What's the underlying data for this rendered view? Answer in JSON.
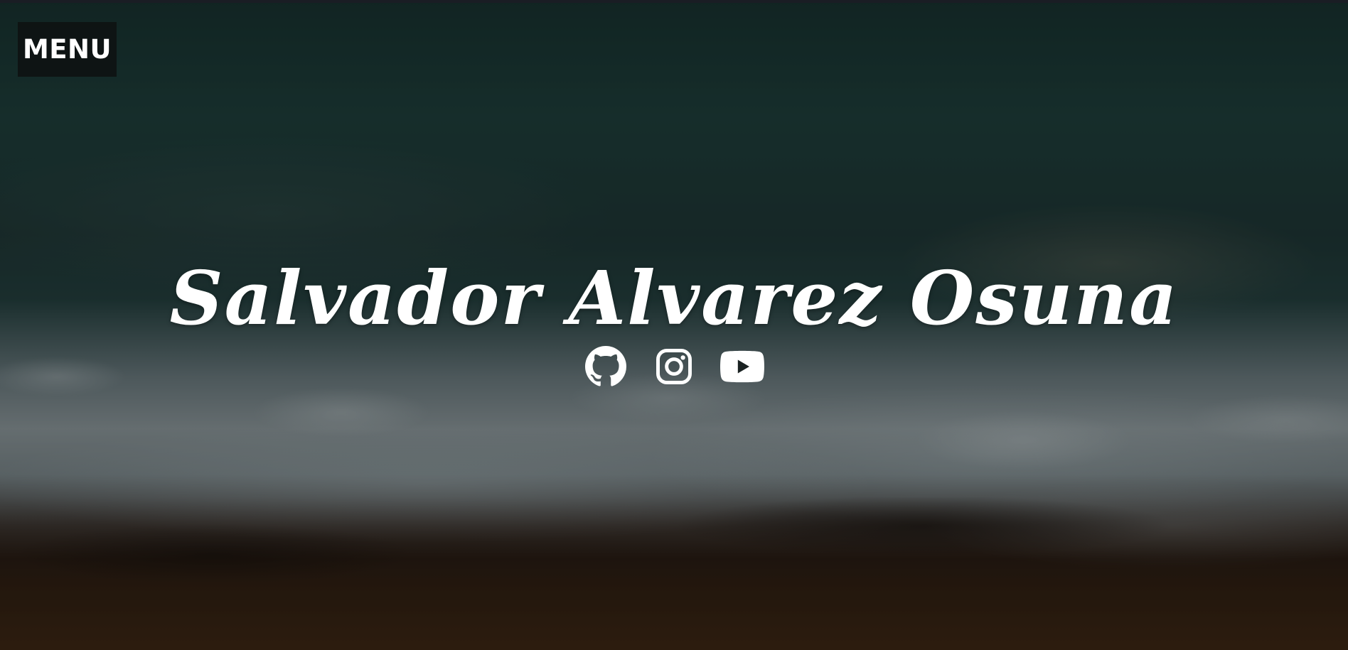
{
  "page": {
    "menu_label": "MENU",
    "title": "Salvador Alvarez Osuna"
  },
  "socials": [
    {
      "icon": "github-icon"
    },
    {
      "icon": "instagram-icon"
    },
    {
      "icon": "youtube-icon"
    }
  ],
  "colors": {
    "text": "#ffffff",
    "menu_bg": "#0e1212",
    "overlay": "rgba(0,0,0,0.38)"
  }
}
